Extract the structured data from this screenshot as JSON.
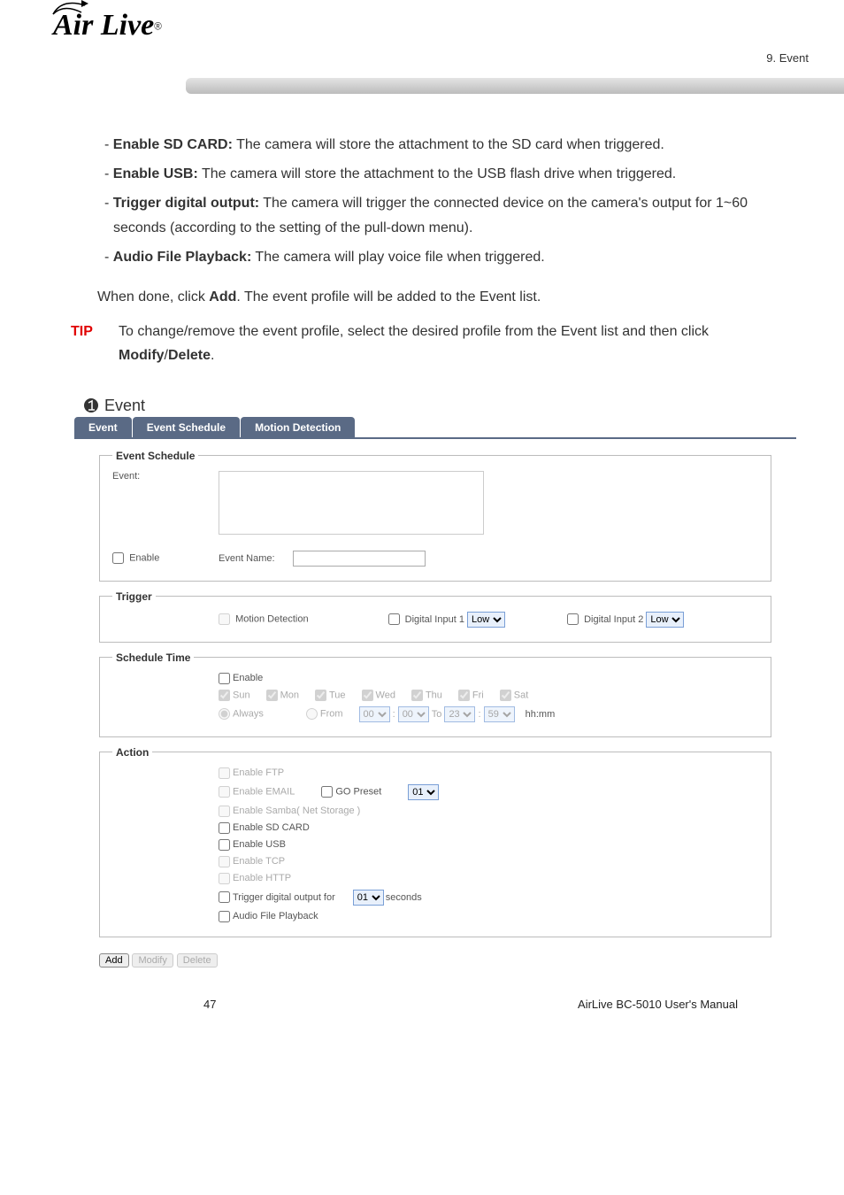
{
  "header": {
    "section": "9. Event",
    "logo_main": "Air Live",
    "logo_sup": "®"
  },
  "body": {
    "bullets": [
      {
        "label": "Enable SD CARD:",
        "text": " The camera will store the attachment to the SD card when triggered."
      },
      {
        "label": "Enable USB:",
        "text": " The camera will store the attachment to the USB flash drive when triggered."
      },
      {
        "label": "Trigger digital output:",
        "text": " The camera will trigger the connected device on the camera's output for 1~60 seconds (according to the setting of the pull-down menu)."
      },
      {
        "label": "Audio File Playback:",
        "text": " The camera will play voice file when triggered."
      }
    ],
    "done_prefix": "When done, click ",
    "done_bold": "Add",
    "done_suffix": ". The event profile will be added to the Event list.",
    "tip_label": "TIP",
    "tip_prefix": "To change/remove the event profile, select the desired profile from the Event list and then click ",
    "tip_bold1": "Modify",
    "tip_sep": "/",
    "tip_bold2": "Delete",
    "tip_end": "."
  },
  "panel": {
    "title": "Event",
    "tabs": {
      "t1": "Event",
      "t2": "Event Schedule",
      "t3": "Motion Detection"
    },
    "eventSchedule": {
      "legend": "Event Schedule",
      "eventLabel": "Event:",
      "enableLabel": "Enable",
      "eventNameLabel": "Event Name:"
    },
    "trigger": {
      "legend": "Trigger",
      "motion": "Motion Detection",
      "di1": "Digital Input 1",
      "di2": "Digital Input 2",
      "low": "Low"
    },
    "schedule": {
      "legend": "Schedule Time",
      "enable": "Enable",
      "sun": "Sun",
      "mon": "Mon",
      "tue": "Tue",
      "wed": "Wed",
      "thu": "Thu",
      "fri": "Fri",
      "sat": "Sat",
      "always": "Always",
      "from": "From",
      "to": "To",
      "h1": "00",
      "m1": "00",
      "h2": "23",
      "m2": "59",
      "hhmm": "hh:mm"
    },
    "action": {
      "legend": "Action",
      "ftp": "Enable FTP",
      "email": "Enable EMAIL",
      "gopreset": "GO Preset",
      "presetVal": "01",
      "samba": "Enable Samba( Net Storage )",
      "sdcard": "Enable SD CARD",
      "usb": "Enable USB",
      "tcp": "Enable TCP",
      "http": "Enable HTTP",
      "triggerOut": "Trigger digital output for",
      "triggerSec": "01",
      "seconds": "seconds",
      "audio": "Audio File Playback"
    },
    "buttons": {
      "add": "Add",
      "modify": "Modify",
      "delete": "Delete"
    }
  },
  "footer": {
    "page": "47",
    "manual": "AirLive BC-5010 User's Manual"
  }
}
